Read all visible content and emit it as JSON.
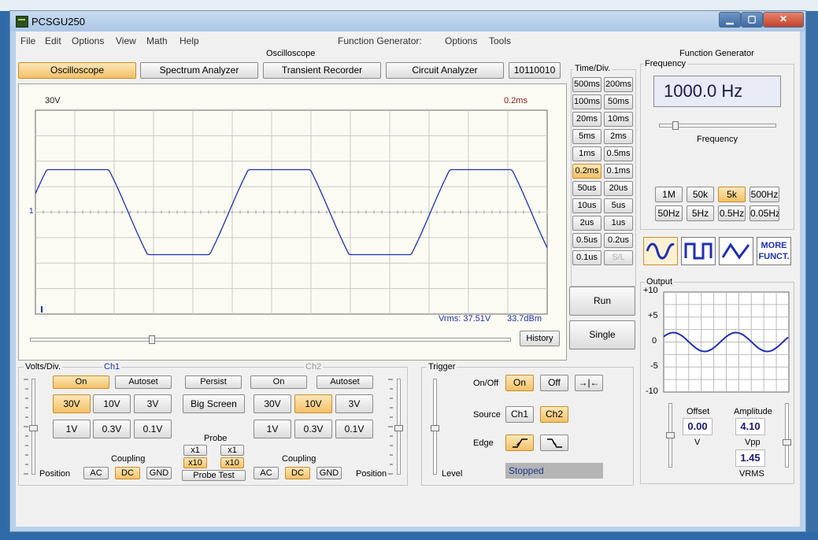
{
  "window": {
    "title": "PCSGU250",
    "controls": {
      "minimize": "▁",
      "maximize": "▢",
      "close": "✕"
    }
  },
  "menu": [
    "File",
    "Edit",
    "Options",
    "View",
    "Math",
    "Help"
  ],
  "fg_menu": {
    "label": "Function Generator:",
    "items": [
      "Options",
      "Tools"
    ]
  },
  "oscilloscope": {
    "section_title": "Oscilloscope",
    "tabs": [
      {
        "label": "Oscilloscope",
        "active": true
      },
      {
        "label": "Spectrum Analyzer",
        "active": false
      },
      {
        "label": "Transient Recorder",
        "active": false
      },
      {
        "label": "Circuit Analyzer",
        "active": false
      },
      {
        "label": "10110010",
        "active": false
      }
    ],
    "screen": {
      "volt_label": "30V",
      "time_label": "0.2ms",
      "ch_marker": "1",
      "vrms": "Vrms: 37.51V",
      "dbm": "33.7dBm",
      "trace_color": "#1f2fb3"
    },
    "history_label": "History"
  },
  "timediv": {
    "title": "Time/Div.",
    "buttons": [
      [
        "500ms",
        "200ms"
      ],
      [
        "100ms",
        "50ms"
      ],
      [
        "20ms",
        "10ms"
      ],
      [
        "5ms",
        "2ms"
      ],
      [
        "1ms",
        "0.5ms"
      ],
      [
        "0.2ms",
        "0.1ms"
      ],
      [
        "50us",
        "20us"
      ],
      [
        "10us",
        "5us"
      ],
      [
        "2us",
        "1us"
      ],
      [
        "0.5us",
        "0.2us"
      ],
      [
        "0.1us",
        "S/L"
      ]
    ],
    "active": "0.2ms",
    "disabled": "S/L",
    "run_label": "Run",
    "single_label": "Single"
  },
  "volts": {
    "title": "Volts/Div.",
    "ch1_label": "Ch1",
    "ch2_label": "Ch2",
    "position_label": "Position",
    "ch1": {
      "on": "On",
      "autoset": "Autoset",
      "ranges": [
        "30V",
        "10V",
        "3V",
        "1V",
        "0.3V",
        "0.1V"
      ],
      "active": "30V"
    },
    "ch2": {
      "on": "On",
      "autoset": "Autoset",
      "ranges": [
        "30V",
        "10V",
        "3V",
        "1V",
        "0.3V",
        "0.1V"
      ],
      "active": "10V"
    },
    "persist": "Persist",
    "big_screen": "Big Screen",
    "probe_title": "Probe",
    "probe": {
      "x1a": "x1",
      "x1b": "x1",
      "x10a": "x10",
      "x10b": "x10"
    },
    "probe_test": "Probe Test",
    "coupling_title": "Coupling",
    "coupling": [
      "AC",
      "DC",
      "GND"
    ],
    "coupling_active": "DC"
  },
  "trigger": {
    "title": "Trigger",
    "onoff_label": "On/Off",
    "on": "On",
    "off": "Off",
    "center_sym": "→|←",
    "source_label": "Source",
    "sources": [
      "Ch1",
      "Ch2"
    ],
    "source_active": "Ch2",
    "edge_label": "Edge",
    "level_label": "Level",
    "status": "Stopped"
  },
  "function_generator": {
    "title": "Function Generator",
    "frequency_group": "Frequency",
    "frequency_value": "1000.0 Hz",
    "frequency_slider_label": "Frequency",
    "range_buttons_row1": [
      "1M",
      "50k",
      "5k",
      "500Hz"
    ],
    "range_buttons_row2": [
      "50Hz",
      "5Hz",
      "0.5Hz",
      "0.05Hz"
    ],
    "range_active": "5k",
    "more_label_1": "MORE",
    "more_label_2": "FUNCT.",
    "output_group": "Output",
    "output_ticks": [
      "+10",
      "+5",
      "0",
      "-5",
      "-10"
    ],
    "offset_label": "Offset",
    "offset_value": "0.00",
    "offset_unit": "V",
    "amplitude_label": "Amplitude",
    "amplitude_value": "4.10",
    "amplitude_unit": "Vpp",
    "vrms_value": "1.45",
    "vrms_unit": "VRMS"
  }
}
